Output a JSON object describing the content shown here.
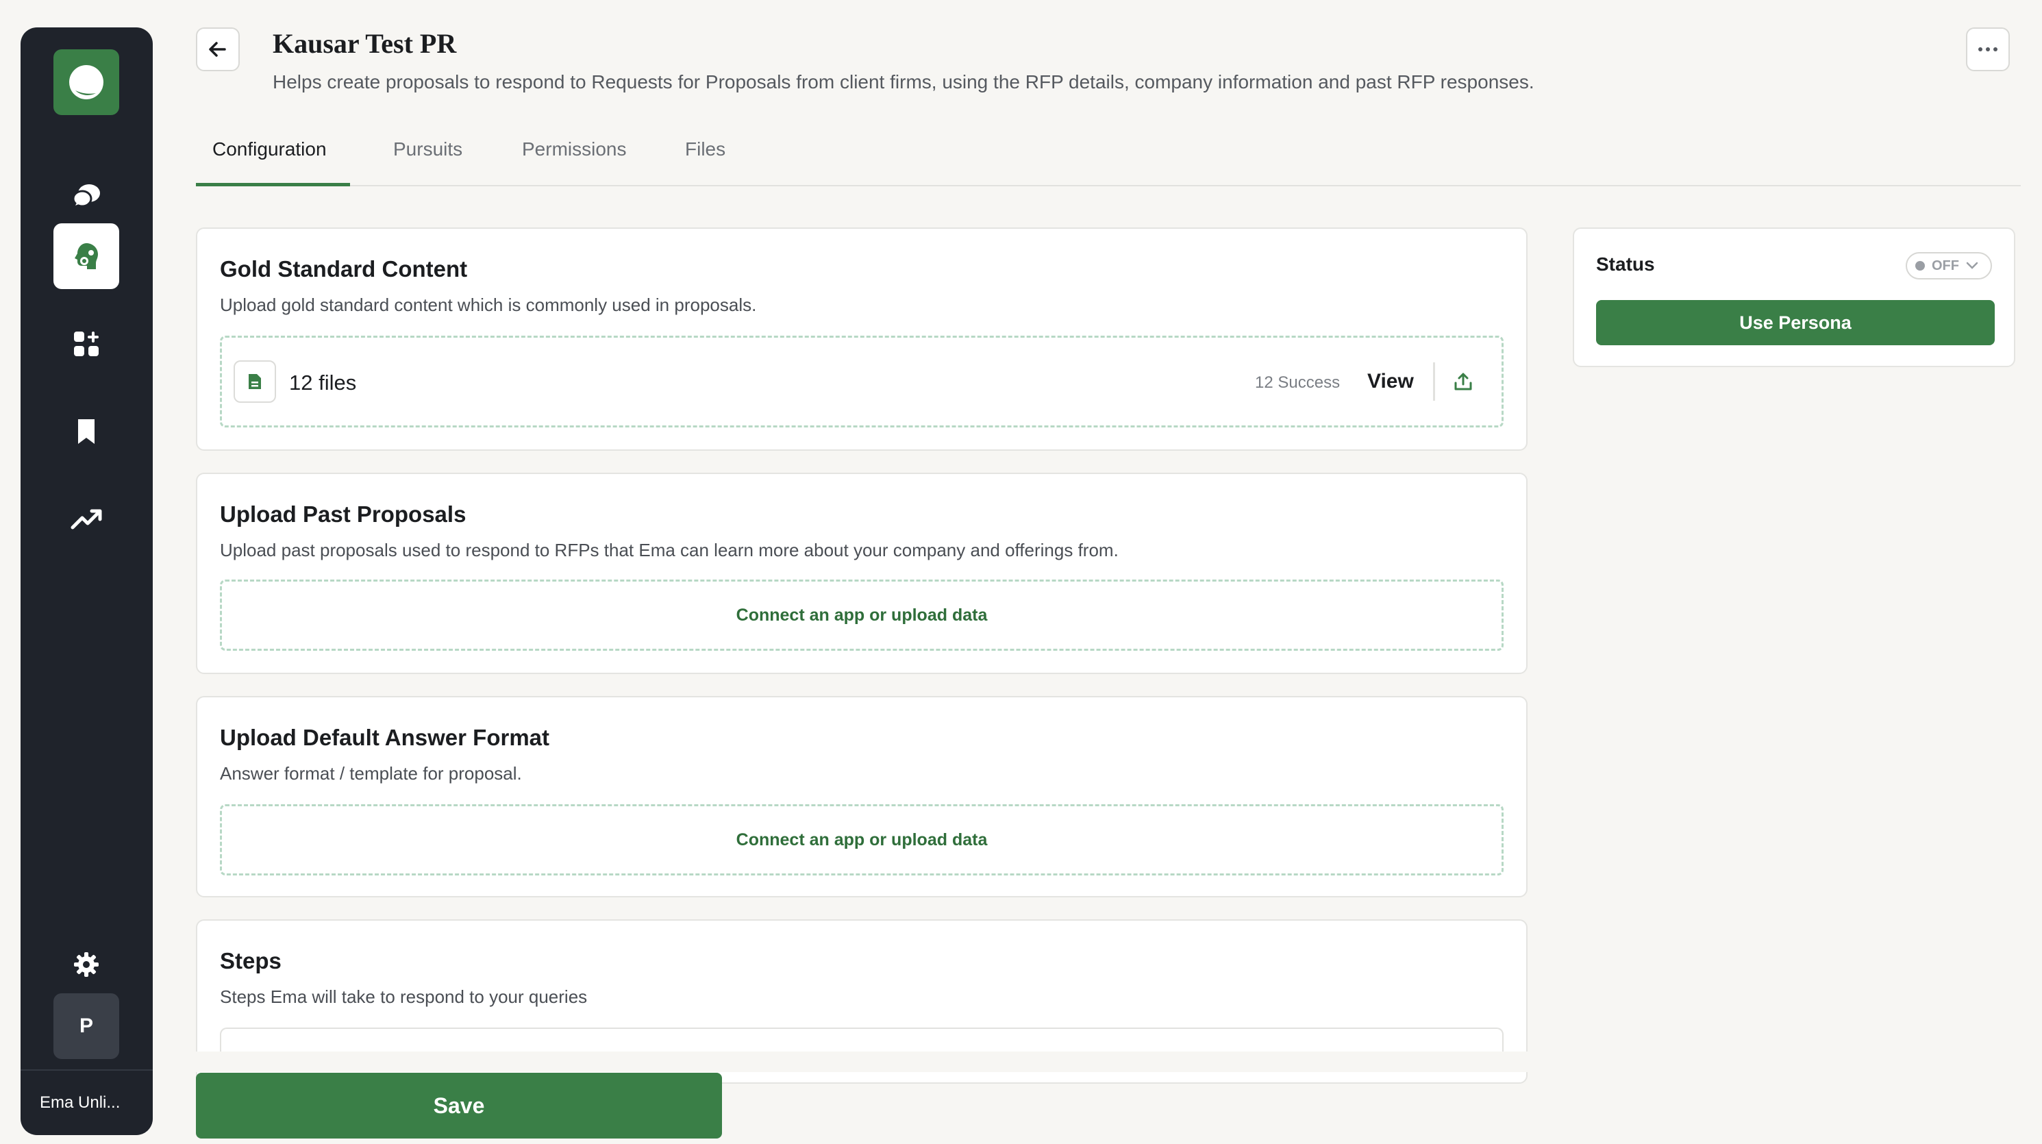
{
  "sidebar": {
    "items": [
      {
        "name": "logo",
        "icon": "ema-logo-icon"
      },
      {
        "name": "chat",
        "icon": "chat-bubbles-icon"
      },
      {
        "name": "personas",
        "icon": "ai-brain-icon",
        "active": true
      },
      {
        "name": "apps",
        "icon": "apps-grid-icon"
      },
      {
        "name": "saved",
        "icon": "bookmark-icon"
      },
      {
        "name": "analytics",
        "icon": "trending-up-icon"
      },
      {
        "name": "settings",
        "icon": "gear-icon"
      }
    ],
    "avatar_initial": "P",
    "workspace_name": "Ema Unli..."
  },
  "header": {
    "title": "Kausar Test PR",
    "description": "Helps create proposals to respond to Requests for Proposals from client firms, using the RFP details, company information and past RFP responses."
  },
  "tabs": [
    {
      "label": "Configuration",
      "active": true
    },
    {
      "label": "Pursuits"
    },
    {
      "label": "Permissions"
    },
    {
      "label": "Files"
    }
  ],
  "sections": {
    "gold": {
      "title": "Gold Standard Content",
      "description": "Upload gold standard content which is commonly used in proposals.",
      "file_count": "12 files",
      "success": "12 Success",
      "view_label": "View"
    },
    "past": {
      "title": "Upload Past Proposals",
      "description": "Upload past proposals used to respond to RFPs that Ema can learn more about your company and offerings from.",
      "connect_label": "Connect an app or upload data"
    },
    "format": {
      "title": "Upload Default Answer Format",
      "description": "Answer format / template for proposal.",
      "connect_label": "Connect an app or upload data"
    },
    "steps": {
      "title": "Steps",
      "description": "Steps Ema will take to respond to your queries"
    }
  },
  "status": {
    "label": "Status",
    "toggle_text": "OFF",
    "button_label": "Use Persona"
  },
  "footer": {
    "save_label": "Save"
  },
  "colors": {
    "brand_green": "#3a7f47",
    "sidebar_bg": "#1f232b",
    "page_bg": "#f7f6f3"
  }
}
